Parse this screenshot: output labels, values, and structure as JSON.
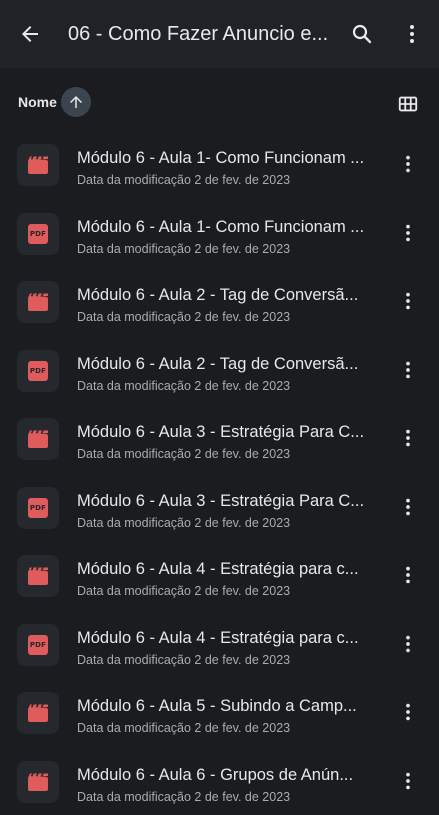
{
  "appbar": {
    "title": "06 - Como Fazer Anuncio e...",
    "back_icon": "arrow-left-icon",
    "search_icon": "search-icon",
    "more_icon": "more-vertical-icon"
  },
  "sort": {
    "label": "Nome",
    "direction_icon": "arrow-up-icon",
    "view_icon": "grid-view-icon"
  },
  "colors": {
    "background": "#1a1c1f",
    "appbar": "#1f2327",
    "accent": "#e05b5b",
    "sort_chip": "#3b4550"
  },
  "files": [
    {
      "type": "video",
      "name": "Módulo 6 - Aula 1- Como Funcionam ...",
      "meta": "Data da modificação 2 de fev. de 2023"
    },
    {
      "type": "pdf",
      "name": "Módulo 6 - Aula 1- Como Funcionam ...",
      "meta": "Data da modificação 2 de fev. de 2023",
      "badge": "PDF"
    },
    {
      "type": "video",
      "name": "Módulo 6 - Aula 2 - Tag de Conversã...",
      "meta": "Data da modificação 2 de fev. de 2023"
    },
    {
      "type": "pdf",
      "name": "Módulo 6 - Aula 2 - Tag de Conversã...",
      "meta": "Data da modificação 2 de fev. de 2023",
      "badge": "PDF"
    },
    {
      "type": "video",
      "name": "Módulo 6 - Aula 3 - Estratégia Para C...",
      "meta": "Data da modificação 2 de fev. de 2023"
    },
    {
      "type": "pdf",
      "name": "Módulo 6 - Aula 3 - Estratégia Para C...",
      "meta": "Data da modificação 2 de fev. de 2023",
      "badge": "PDF"
    },
    {
      "type": "video",
      "name": "Módulo 6 - Aula 4 - Estratégia para c...",
      "meta": "Data da modificação 2 de fev. de 2023"
    },
    {
      "type": "pdf",
      "name": "Módulo 6 - Aula 4 - Estratégia para c...",
      "meta": "Data da modificação 2 de fev. de 2023",
      "badge": "PDF"
    },
    {
      "type": "video",
      "name": "Módulo 6 - Aula 5 - Subindo a Camp...",
      "meta": "Data da modificação 2 de fev. de 2023"
    },
    {
      "type": "video",
      "name": "Módulo 6 - Aula 6 - Grupos de Anún...",
      "meta": "Data da modificação 2 de fev. de 2023"
    }
  ]
}
